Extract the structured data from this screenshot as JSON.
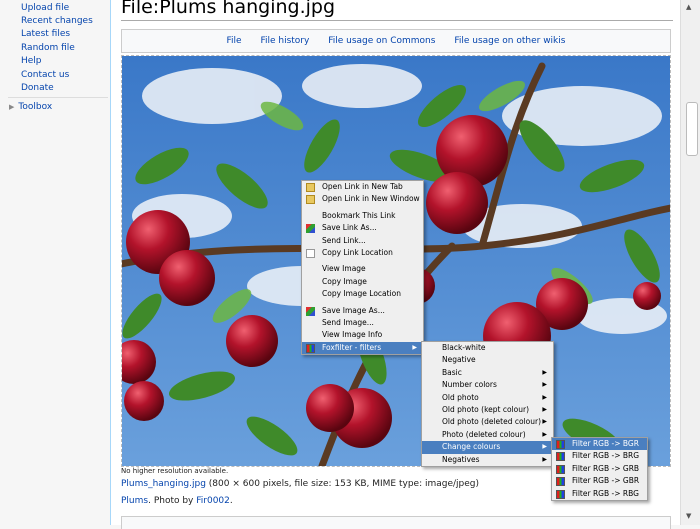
{
  "sidebar": {
    "links": [
      "Upload file",
      "Recent changes",
      "Latest files",
      "Random file",
      "Help",
      "Contact us",
      "Donate"
    ],
    "toolbox": "Toolbox"
  },
  "page": {
    "title": "File:Plums hanging.jpg",
    "tabs": [
      "File",
      "File history",
      "File usage on Commons",
      "File usage on other wikis"
    ],
    "no_higher": "No higher resolution available.",
    "file_link": "Plums_hanging.jpg",
    "file_meta": " (800 × 600 pixels, file size: 153 KB, MIME type: image/jpeg)",
    "desc_link1": "Plums",
    "desc_text": ". Photo by ",
    "desc_link2": "Fir0002",
    "desc_end": "."
  },
  "context_menu": {
    "items": [
      {
        "label": "Open Link in New Tab",
        "icon": "folder-icon"
      },
      {
        "label": "Open Link in New Window",
        "icon": "folder-icon"
      },
      {
        "sep": true
      },
      {
        "label": "Bookmark This Link",
        "icon": ""
      },
      {
        "label": "Save Link As...",
        "icon": "save-icon"
      },
      {
        "label": "Send Link...",
        "icon": ""
      },
      {
        "label": "Copy Link Location",
        "icon": "page-icon"
      },
      {
        "sep": true
      },
      {
        "label": "View Image",
        "icon": ""
      },
      {
        "label": "Copy Image",
        "icon": ""
      },
      {
        "label": "Copy Image Location",
        "icon": ""
      },
      {
        "sep": true
      },
      {
        "label": "Save Image As...",
        "icon": "save-icon"
      },
      {
        "label": "Send Image...",
        "icon": ""
      },
      {
        "label": "View Image Info",
        "icon": ""
      },
      {
        "label": "Foxfilter - filters",
        "icon": "grid-icon",
        "submenu": true,
        "highlight": true
      }
    ]
  },
  "foxfilter_menu": {
    "items": [
      {
        "label": "Black-white"
      },
      {
        "label": "Negative"
      },
      {
        "label": "Basic",
        "submenu": true
      },
      {
        "label": "Number colors",
        "submenu": true
      },
      {
        "label": "Old photo",
        "submenu": true
      },
      {
        "label": "Old photo (kept colour)",
        "submenu": true
      },
      {
        "label": "Old photo (deleted colour)",
        "submenu": true
      },
      {
        "label": "Photo (deleted colour)",
        "submenu": true
      },
      {
        "label": "Change colours",
        "submenu": true,
        "highlight": true
      },
      {
        "label": "Negatives",
        "submenu": true
      }
    ]
  },
  "change_colours_menu": {
    "items": [
      {
        "label": "Filter RGB -> BGR",
        "highlight": true
      },
      {
        "label": "Filter RGB -> BRG"
      },
      {
        "label": "Filter RGB -> GRB"
      },
      {
        "label": "Filter RGB -> GBR"
      },
      {
        "label": "Filter RGB -> RBG"
      }
    ]
  },
  "colors": {
    "link": "#0645ad",
    "menu_highlight": "#4a7fc0",
    "sky": "#4a86d0",
    "plum": "#b3132b",
    "leaf": "#3f8a2a"
  }
}
